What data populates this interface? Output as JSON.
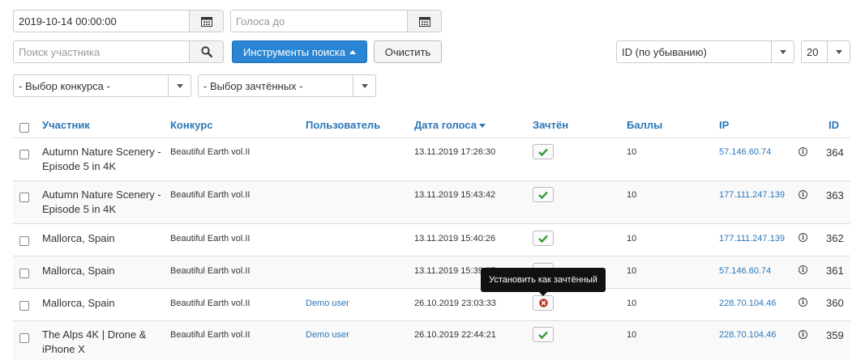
{
  "filters": {
    "date_from_value": "2019-10-14 00:00:00",
    "votes_to_placeholder": "Голоса до",
    "search_placeholder": "Поиск участника",
    "search_tools_label": "Инструменты поиска",
    "clear_label": "Очистить",
    "ordering_value": "ID (по убыванию)",
    "limit_value": "20",
    "contest_select": "- Выбор конкурса -",
    "accepted_select": "- Выбор зачтённых -"
  },
  "table": {
    "headers": {
      "participant": "Участник",
      "contest": "Конкурс",
      "user": "Пользователь",
      "vote_date": "Дата голоса",
      "accepted": "Зачтён",
      "points": "Баллы",
      "ip": "IP",
      "id": "ID"
    },
    "rows": [
      {
        "participant": "Autumn Nature Scenery - Episode 5 in 4K",
        "contest": "Beautiful Earth vol.II",
        "user": "",
        "date": "13.11.2019 17:26:30",
        "accepted": true,
        "points": "10",
        "ip": "57.146.60.74",
        "id": "364"
      },
      {
        "participant": "Autumn Nature Scenery - Episode 5 in 4K",
        "contest": "Beautiful Earth vol.II",
        "user": "",
        "date": "13.11.2019 15:43:42",
        "accepted": true,
        "points": "10",
        "ip": "177.111.247.139",
        "id": "363"
      },
      {
        "participant": "Mallorca, Spain",
        "contest": "Beautiful Earth vol.II",
        "user": "",
        "date": "13.11.2019 15:40:26",
        "accepted": true,
        "points": "10",
        "ip": "177.111.247.139",
        "id": "362"
      },
      {
        "participant": "Mallorca, Spain",
        "contest": "Beautiful Earth vol.II",
        "user": "",
        "date": "13.11.2019 15:39:27",
        "accepted": true,
        "points": "10",
        "ip": "57.146.60.74",
        "id": "361"
      },
      {
        "participant": "Mallorca, Spain",
        "contest": "Beautiful Earth vol.II",
        "user": "Demo user",
        "date": "26.10.2019 23:03:33",
        "accepted": false,
        "points": "10",
        "ip": "228.70.104.46",
        "id": "360"
      },
      {
        "participant": "The Alps 4K | Drone & iPhone X",
        "contest": "Beautiful Earth vol.II",
        "user": "Demo user",
        "date": "26.10.2019 22:44:21",
        "accepted": true,
        "points": "10",
        "ip": "228.70.104.46",
        "id": "359"
      }
    ]
  },
  "tooltip": {
    "text": "Установить как зачтённый"
  },
  "icons": {
    "calendar": "calendar-icon",
    "search": "search-icon",
    "check": "check-icon",
    "cross": "cross-circle-icon",
    "info": "info-icon"
  },
  "colors": {
    "primary": "#2a85d4",
    "link": "#2a76b8",
    "check_green": "#3c9a3c",
    "cross_red": "#c0392b"
  }
}
